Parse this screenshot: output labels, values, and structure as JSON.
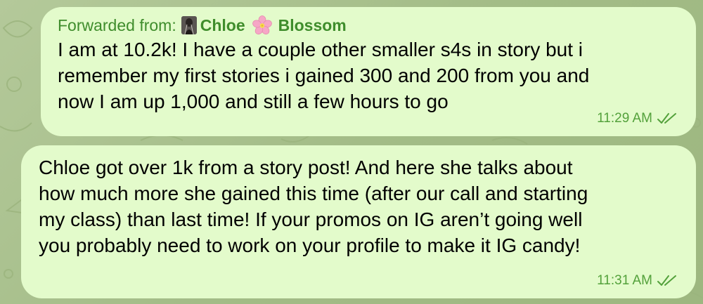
{
  "messages": [
    {
      "forwarded_prefix": "Forwarded from:",
      "forwarded_name_first": "Chloe",
      "forwarded_name_last": "Blossom",
      "text": "I am at 10.2k! I have a couple other smaller s4s in story but i\nremember my first stories i gained 300 and 200 from you and\nnow I am up 1,000 and still a few hours to go",
      "time": "11:29 AM",
      "status": "read"
    },
    {
      "text": "Chloe got over 1k from a story post! And here she talks about\nhow much more she gained this time (after our call and starting\nmy class) than last time! If your promos on IG aren’t going well\nyou probably need to work on your profile to make it IG candy!",
      "time": "11:31 AM",
      "status": "read"
    }
  ],
  "colors": {
    "background": "#a9c08f",
    "bubble": "#e3fbcb",
    "forward_label": "#3f8d2c",
    "meta": "#53a13b"
  },
  "icons": {
    "forward_avatar": "avatar",
    "forward_emoji": "cherry-blossom-icon",
    "read_receipt": "double-check-icon"
  }
}
